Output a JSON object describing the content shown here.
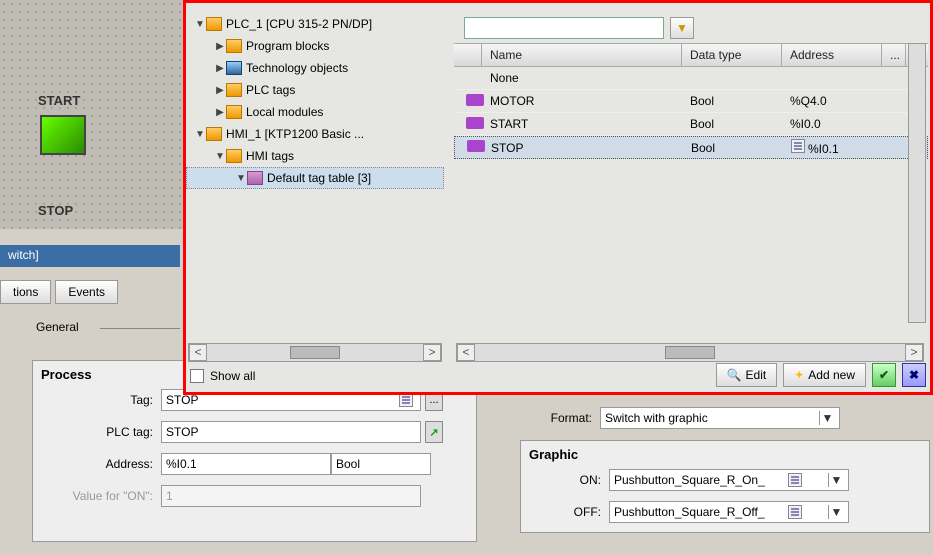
{
  "canvas": {
    "start": "START",
    "stop": "STOP"
  },
  "prop_header": "witch]",
  "tabs": {
    "tions": "tions",
    "events": "Events"
  },
  "general": "General",
  "process": {
    "title": "Process",
    "tag_lbl": "Tag:",
    "tag_val": "STOP",
    "plctag_lbl": "PLC tag:",
    "plctag_val": "STOP",
    "addr_lbl": "Address:",
    "addr_val": "%I0.1",
    "addr_type": "Bool",
    "valon_lbl": "Value for \"ON\":",
    "valon_val": "1"
  },
  "format": {
    "lbl": "Format:",
    "val": "Switch with graphic"
  },
  "graphic": {
    "title": "Graphic",
    "on_lbl": "ON:",
    "on_val": "Pushbutton_Square_R_On_",
    "off_lbl": "OFF:",
    "off_val": "Pushbutton_Square_R_Off_"
  },
  "tree": {
    "plc": "PLC_1 [CPU 315-2 PN/DP]",
    "prog": "Program blocks",
    "tech": "Technology objects",
    "plctags": "PLC tags",
    "local": "Local modules",
    "hmi": "HMI_1 [KTP1200 Basic ...",
    "hmitags": "HMI tags",
    "deftable": "Default tag table [3]",
    "showall": "Show all"
  },
  "grid": {
    "cols": {
      "name": "Name",
      "type": "Data type",
      "addr": "Address",
      "more": "..."
    },
    "rows": [
      {
        "name": "None",
        "type": "",
        "addr": ""
      },
      {
        "name": "MOTOR",
        "type": "Bool",
        "addr": "%Q4.0"
      },
      {
        "name": "START",
        "type": "Bool",
        "addr": "%I0.0"
      },
      {
        "name": "STOP",
        "type": "Bool",
        "addr": "%I0.1"
      }
    ],
    "edit": "Edit",
    "addnew": "Add new"
  }
}
